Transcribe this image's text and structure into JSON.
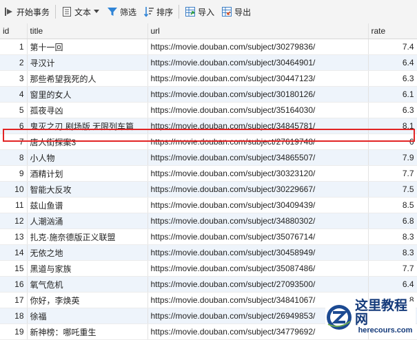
{
  "toolbar": {
    "begin_transaction": "开始事务",
    "text": "文本",
    "filter": "筛选",
    "sort": "排序",
    "import": "导入",
    "export": "导出"
  },
  "columns": [
    "id",
    "title",
    "url",
    "rate"
  ],
  "rows": [
    {
      "id": "1",
      "title": "第十一回",
      "url": "https://movie.douban.com/subject/30279836/",
      "rate": "7.4"
    },
    {
      "id": "2",
      "title": "寻汉计",
      "url": "https://movie.douban.com/subject/30464901/",
      "rate": "6.4"
    },
    {
      "id": "3",
      "title": "那些希望我死的人",
      "url": "https://movie.douban.com/subject/30447123/",
      "rate": "6.3"
    },
    {
      "id": "4",
      "title": "窗里的女人",
      "url": "https://movie.douban.com/subject/30180126/",
      "rate": "6.1"
    },
    {
      "id": "5",
      "title": "孤夜寻凶",
      "url": "https://movie.douban.com/subject/35164030/",
      "rate": "6.3"
    },
    {
      "id": "6",
      "title": "鬼灭之刃 剧场版 无限列车篇",
      "url": "https://movie.douban.com/subject/34845781/",
      "rate": "8.1"
    },
    {
      "id": "7",
      "title": "唐人街探案3",
      "url": "https://movie.douban.com/subject/27619748/",
      "rate": "6"
    },
    {
      "id": "8",
      "title": "小人物",
      "url": "https://movie.douban.com/subject/34865507/",
      "rate": "7.9"
    },
    {
      "id": "9",
      "title": "酒精计划",
      "url": "https://movie.douban.com/subject/30323120/",
      "rate": "7.7"
    },
    {
      "id": "10",
      "title": "智能大反攻",
      "url": "https://movie.douban.com/subject/30229667/",
      "rate": "7.5"
    },
    {
      "id": "11",
      "title": "兹山鱼谱",
      "url": "https://movie.douban.com/subject/30409439/",
      "rate": "8.5"
    },
    {
      "id": "12",
      "title": "人潮汹涌",
      "url": "https://movie.douban.com/subject/34880302/",
      "rate": "6.8"
    },
    {
      "id": "13",
      "title": "扎克·施奈德版正义联盟",
      "url": "https://movie.douban.com/subject/35076714/",
      "rate": "8.3"
    },
    {
      "id": "14",
      "title": "无依之地",
      "url": "https://movie.douban.com/subject/30458949/",
      "rate": "8.3"
    },
    {
      "id": "15",
      "title": "黑道与家族",
      "url": "https://movie.douban.com/subject/35087486/",
      "rate": "7.7"
    },
    {
      "id": "16",
      "title": "氧气危机",
      "url": "https://movie.douban.com/subject/27093500/",
      "rate": "6.4"
    },
    {
      "id": "17",
      "title": "你好，李焕英",
      "url": "https://movie.douban.com/subject/34841067/",
      "rate": "8"
    },
    {
      "id": "18",
      "title": "徐福",
      "url": "https://movie.douban.com/subject/26949853/",
      "rate": "5.9"
    },
    {
      "id": "19",
      "title": "新神榜：哪吒重生",
      "url": "https://movie.douban.com/subject/34779692/",
      "rate": ""
    }
  ],
  "watermark": {
    "title": "这里教程网",
    "site": "herecours.com"
  }
}
